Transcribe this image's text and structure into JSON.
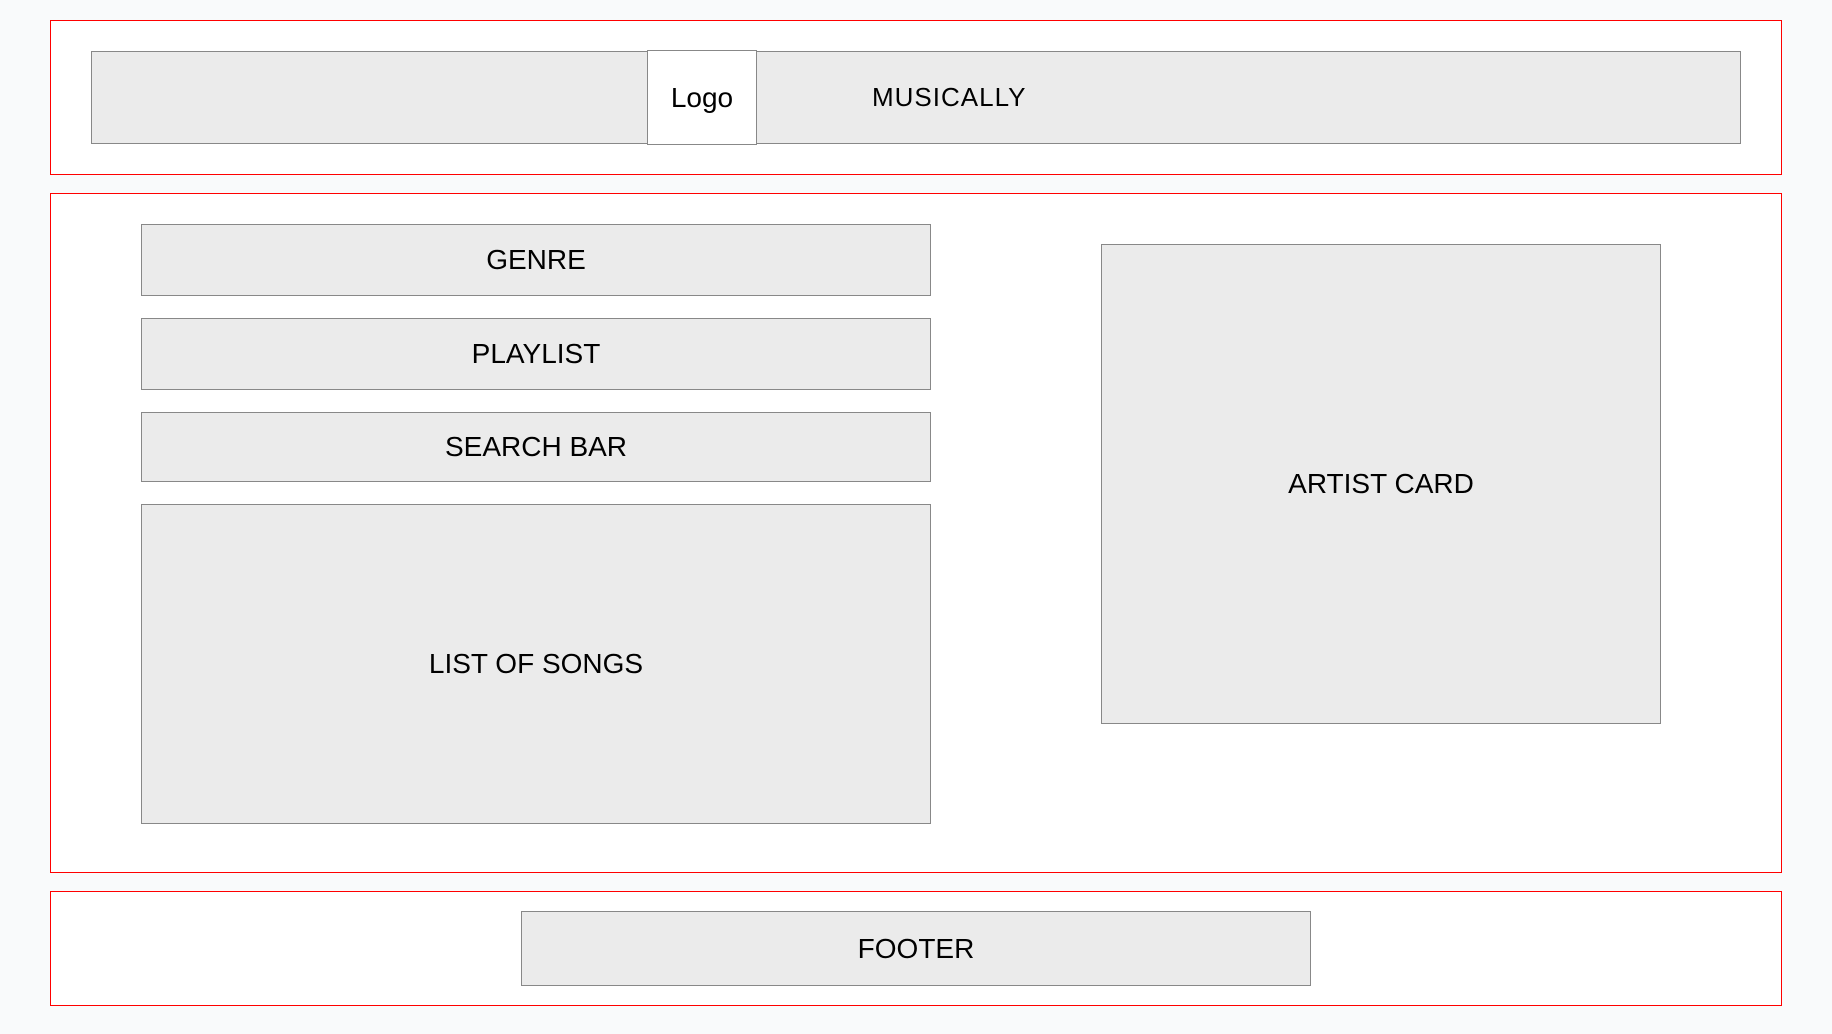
{
  "header": {
    "logo_label": "Logo",
    "app_name": "MUSICALLY"
  },
  "main": {
    "left": {
      "genre_label": "GENRE",
      "playlist_label": "PLAYLIST",
      "search_label": "SEARCH BAR",
      "songs_label": "LIST OF SONGS"
    },
    "right": {
      "artist_card_label": "ARTIST CARD"
    }
  },
  "footer": {
    "label": "FOOTER"
  }
}
